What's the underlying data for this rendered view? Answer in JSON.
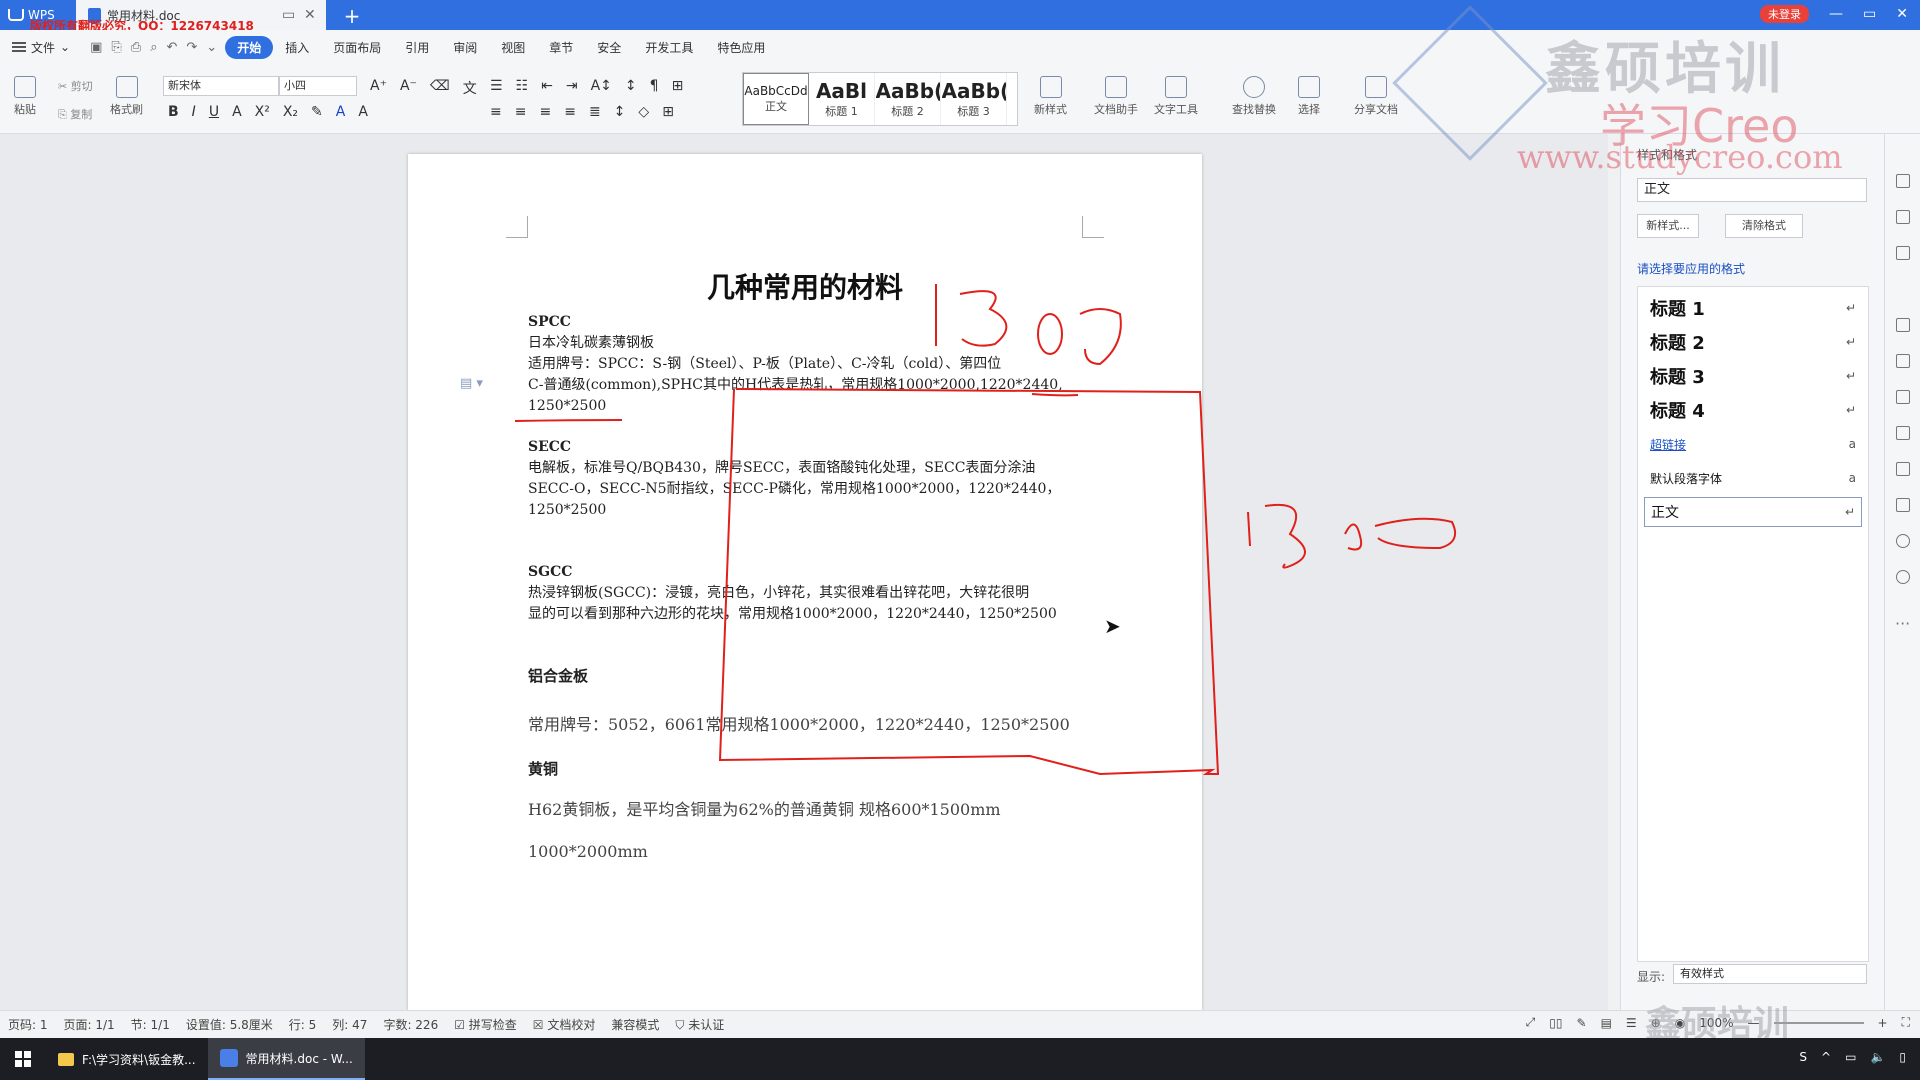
{
  "titlebar": {
    "app_tab": "WPS",
    "doc_tab": "常用材料.doc",
    "copyright": "版权所有翻版必究，QQ：1226743418",
    "login_badge": "未登录"
  },
  "menubar": {
    "file_label": "文件",
    "tabs": [
      "开始",
      "插入",
      "页面布局",
      "引用",
      "审阅",
      "视图",
      "章节",
      "安全",
      "开发工具",
      "特色应用"
    ]
  },
  "ribbon": {
    "paste": "粘贴",
    "cut": "剪切",
    "copy": "复制",
    "format_painter": "格式刷",
    "font_name": "新宋体",
    "font_size": "小四",
    "styles": [
      {
        "preview": "AaBbCcDd",
        "label": "正文"
      },
      {
        "preview": "AaBl",
        "label": "标题 1"
      },
      {
        "preview": "AaBb(",
        "label": "标题 2"
      },
      {
        "preview": "AaBb(",
        "label": "标题 3"
      }
    ],
    "new_style": "新样式",
    "doc_assistant": "文档助手",
    "text_tools": "文字工具",
    "find_replace": "查找替换",
    "select": "选择",
    "share": "分享文档"
  },
  "document": {
    "title": "几种常用的材料",
    "paragraphs": [
      "SPCC",
      "日本冷轧碳素薄钢板",
      "适用牌号：SPCC：S-钢（Steel）、P-板（Plate）、C-冷轧（cold）、第四位",
      "C-普通级(common),SPHC其中的H代表是热轧，常用规格1000*2000,1220*2440,",
      "1250*2500",
      "SECC",
      "电解板，标准号Q/BQB430，牌号SECC，表面铬酸钝化处理，SECC表面分涂油",
      "SECC-O，SECC-N5耐指纹，SECC-P磷化，常用规格1000*2000，1220*2440，",
      "1250*2500",
      "SGCC",
      "热浸锌钢板(SGCC)：浸镀，亮白色，小锌花，其实很难看出锌花吧，大锌花很明",
      "显的可以看到那种六边形的花块，常用规格1000*2000，1220*2440，1250*2500",
      "铝合金板",
      "常用牌号：5052，6061常用规格1000*2000，1220*2440，1250*2500",
      "黄铜",
      "H62黄铜板，是平均含铜量为62%的普通黄铜  规格600*1500mm",
      "1000*2000mm"
    ],
    "annotation_1": "1300",
    "annotation_2": "1300"
  },
  "pane": {
    "current_style_label": "样式和格式",
    "current_style": "正文",
    "new_style_btn": "新样式...",
    "clear_format_btn": "清除格式",
    "apply_label": "请选择要应用的格式",
    "items": [
      "标题 1",
      "标题 2",
      "标题 3",
      "标题 4",
      "超链接",
      "默认段落字体",
      "正文"
    ],
    "show_label": "显示:",
    "show_value": "有效样式"
  },
  "statusbar": {
    "page": "页码: 1",
    "pages": "页面: 1/1",
    "section": "节: 1/1",
    "position": "设置值: 5.8厘米",
    "row": "行: 5",
    "col": "列: 47",
    "words": "字数: 226",
    "spell": "拼写检查",
    "proof": "文档校对",
    "compat": "兼容模式",
    "auth": "未认证",
    "zoom": "100%"
  },
  "taskbar": {
    "folder": "F:\\学习资料\\钣金教...",
    "wps": "常用材料.doc - W..."
  },
  "watermark": {
    "line1": "鑫硕培训",
    "line2": "学习Creo",
    "line3": "www.studycreo.com",
    "bottom": "鑫硕培训"
  },
  "colors": {
    "accent": "#2f6fe0",
    "annotation": "#e0201a"
  }
}
